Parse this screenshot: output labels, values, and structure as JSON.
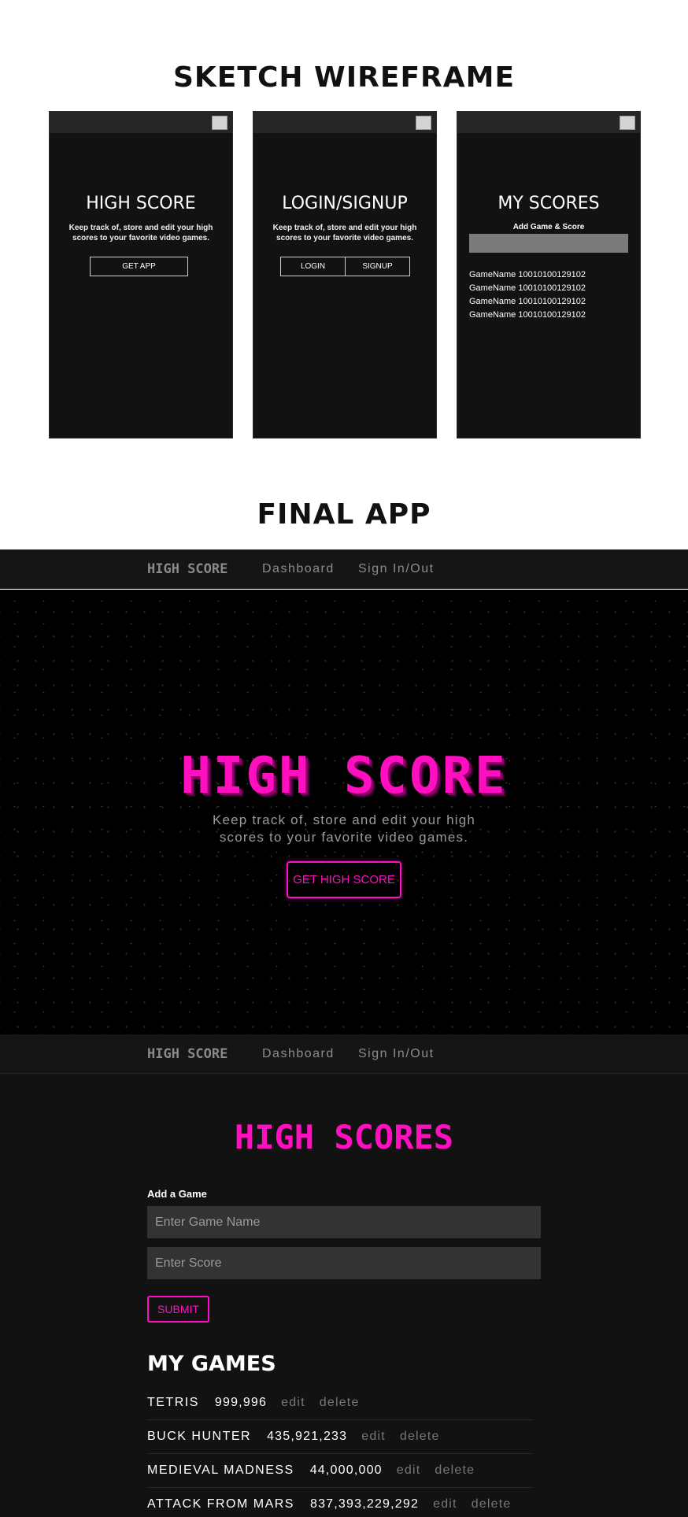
{
  "sections": {
    "wireframe_title": "SKETCH WIREFRAME",
    "final_title": "FINAL APP"
  },
  "wireframes": {
    "home": {
      "title": "HIGH SCORE",
      "description": "Keep track of, store and edit your high scores to your favorite video games.",
      "button": "GET APP"
    },
    "login": {
      "title": "LOGIN/SIGNUP",
      "description": "Keep track of, store and edit your high scores to your favorite video games.",
      "login_button": "LOGIN",
      "signup_button": "SIGNUP"
    },
    "scores": {
      "title": "MY SCORES",
      "subtitle": "Add Game & Score",
      "items": [
        "GameName 10010100129102",
        "GameName 10010100129102",
        "GameName 10010100129102",
        "GameName 10010100129102"
      ]
    }
  },
  "nav": {
    "brand": "HIGH SCORE",
    "links": [
      "Dashboard",
      "Sign In/Out"
    ]
  },
  "hero": {
    "title": "HIGH SCORE",
    "description_line1": "Keep track of, store and edit your high",
    "description_line2": "scores to your favorite video games.",
    "button": "GET HIGH SCORE"
  },
  "dashboard": {
    "title": "HIGH SCORES",
    "add_label": "Add a Game",
    "game_placeholder": "Enter Game Name",
    "score_placeholder": "Enter Score",
    "submit": "SUBMIT",
    "games_title": "MY GAMES",
    "games": [
      {
        "name": "TETRIS",
        "score": "999,996",
        "edit": "edit",
        "delete": "delete"
      },
      {
        "name": "BUCK HUNTER",
        "score": "435,921,233",
        "edit": "edit",
        "delete": "delete"
      },
      {
        "name": "MEDIEVAL MADNESS",
        "score": "44,000,000",
        "edit": "edit",
        "delete": "delete"
      },
      {
        "name": "ATTACK FROM MARS",
        "score": "837,393,229,292",
        "edit": "edit",
        "delete": "delete"
      }
    ]
  },
  "colors": {
    "accent": "#ff0fbf",
    "background_dark": "#121212",
    "hero_background": "#000000"
  }
}
